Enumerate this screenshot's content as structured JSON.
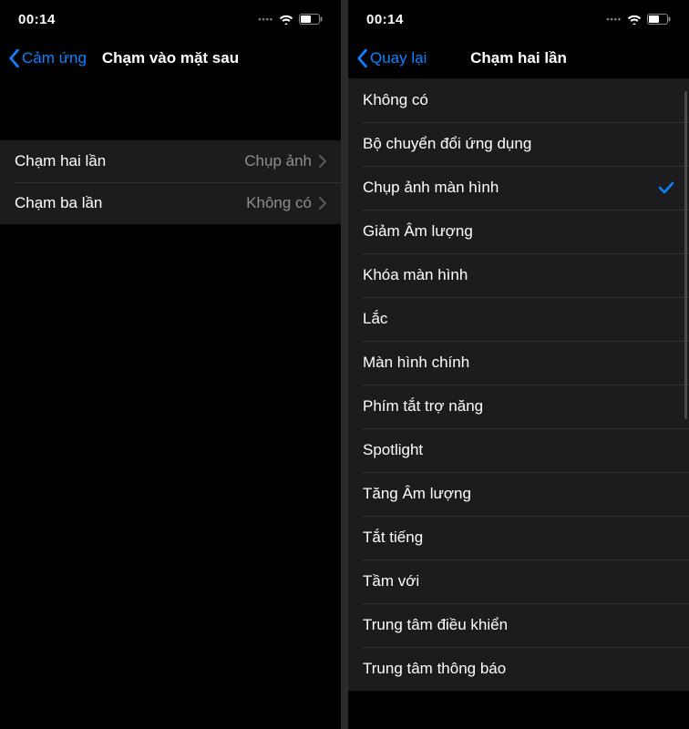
{
  "status": {
    "time": "00:14"
  },
  "screen1": {
    "back_label": "Cảm ứng",
    "title": "Chạm vào mặt sau",
    "rows": [
      {
        "label": "Chạm hai lần",
        "value": "Chụp ảnh"
      },
      {
        "label": "Chạm ba lần",
        "value": "Không có"
      }
    ]
  },
  "screen2": {
    "back_label": "Quay lại",
    "title": "Chạm hai lần",
    "options": [
      {
        "label": "Không có",
        "checked": false
      },
      {
        "label": "Bộ chuyển đổi ứng dụng",
        "checked": false
      },
      {
        "label": "Chụp ảnh màn hình",
        "checked": true
      },
      {
        "label": "Giảm Âm lượng",
        "checked": false
      },
      {
        "label": "Khóa màn hình",
        "checked": false
      },
      {
        "label": "Lắc",
        "checked": false
      },
      {
        "label": "Màn hình chính",
        "checked": false
      },
      {
        "label": "Phím tắt trợ năng",
        "checked": false
      },
      {
        "label": "Spotlight",
        "checked": false
      },
      {
        "label": "Tăng Âm lượng",
        "checked": false
      },
      {
        "label": "Tắt tiếng",
        "checked": false
      },
      {
        "label": "Tầm với",
        "checked": false
      },
      {
        "label": "Trung tâm điều khiển",
        "checked": false
      },
      {
        "label": "Trung tâm thông báo",
        "checked": false
      }
    ]
  }
}
